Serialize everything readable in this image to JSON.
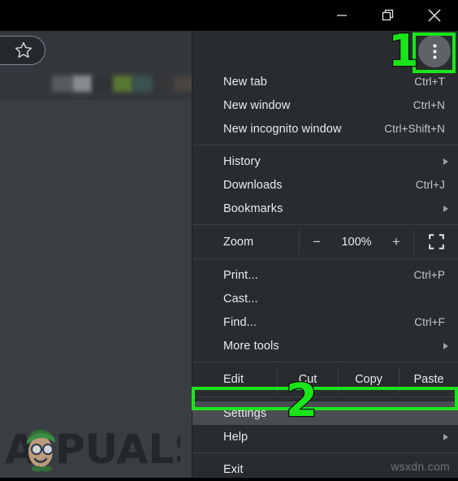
{
  "window": {
    "controls": [
      {
        "name": "minimize-button",
        "icon": "minimize-icon",
        "label": "Minimize"
      },
      {
        "name": "restore-button",
        "icon": "restore-icon",
        "label": "Restore"
      },
      {
        "name": "close-button",
        "icon": "close-icon",
        "label": "Close"
      }
    ]
  },
  "toolbar": {
    "bookmark_star": {
      "icon": "star-icon",
      "label": "Bookmark this tab"
    },
    "bookmark_row1_colors": [
      "#5a5d62",
      "#8d9196",
      "#2f3236",
      "#5c7a33",
      "#3c5550",
      "#343638",
      "#4a4540",
      "#7d6a57",
      "#2f3236",
      "#3ebda0",
      "#2e8c78",
      "#6e2b2b",
      "#e0665f",
      "#6a4238",
      "#b8762e",
      "#4a4d52",
      "#5d7a2c",
      "#a8d84a",
      "#6d2a2a",
      "#3a3d42"
    ],
    "bookmark_row2_colors": [
      "#3a3d42",
      "#54575c",
      "#4e5156",
      "#44474c",
      "#3e4146",
      "#2f3236",
      "#9ba0a5",
      "#60636a",
      "#54575c",
      "#4a4d52",
      "#5c5f64",
      "#4e5156",
      "#585b60",
      "#4a4d52",
      "#60636a",
      "#515459"
    ]
  },
  "menu": {
    "sections": [
      {
        "name": "new-section",
        "items": [
          {
            "name": "menu-item-new-tab",
            "label": "New tab",
            "accel": "Ctrl+T",
            "submenu": false
          },
          {
            "name": "menu-item-new-window",
            "label": "New window",
            "accel": "Ctrl+N",
            "submenu": false
          },
          {
            "name": "menu-item-new-incognito-window",
            "label": "New incognito window",
            "accel": "Ctrl+Shift+N",
            "submenu": false
          }
        ]
      },
      {
        "name": "browse-section",
        "items": [
          {
            "name": "menu-item-history",
            "label": "History",
            "accel": "",
            "submenu": true
          },
          {
            "name": "menu-item-downloads",
            "label": "Downloads",
            "accel": "Ctrl+J",
            "submenu": false
          },
          {
            "name": "menu-item-bookmarks",
            "label": "Bookmarks",
            "accel": "",
            "submenu": true
          }
        ]
      },
      {
        "name": "tools-section",
        "items": [
          {
            "name": "menu-item-print",
            "label": "Print...",
            "accel": "Ctrl+P",
            "submenu": false
          },
          {
            "name": "menu-item-cast",
            "label": "Cast...",
            "accel": "",
            "submenu": false
          },
          {
            "name": "menu-item-find",
            "label": "Find...",
            "accel": "Ctrl+F",
            "submenu": false
          },
          {
            "name": "menu-item-more-tools",
            "label": "More tools",
            "accel": "",
            "submenu": true
          }
        ]
      },
      {
        "name": "bottom-section",
        "items": [
          {
            "name": "menu-item-settings",
            "label": "Settings",
            "accel": "",
            "submenu": false
          },
          {
            "name": "menu-item-help",
            "label": "Help",
            "accel": "",
            "submenu": true
          }
        ]
      },
      {
        "name": "exit-section",
        "items": [
          {
            "name": "menu-item-exit",
            "label": "Exit",
            "accel": "",
            "submenu": false
          }
        ]
      }
    ],
    "zoom_row": {
      "label": "Zoom",
      "decrease": "−",
      "value": "100%",
      "increase": "+",
      "fullscreen_icon": "fullscreen-icon"
    },
    "edit_row": {
      "label": "Edit",
      "cut": "Cut",
      "copy": "Copy",
      "paste": "Paste"
    },
    "more_button": {
      "name": "chrome-menu-button",
      "icon": "three-dots-vertical-icon"
    }
  },
  "annotations": [
    {
      "name": "step-1-marker",
      "number": "1",
      "color": "#1ae51a",
      "target": "chrome-menu-button"
    },
    {
      "name": "step-2-marker",
      "number": "2",
      "color": "#1ae51a",
      "target": "menu-item-settings"
    }
  ],
  "watermarks": {
    "brand": "APPUALS",
    "site": "wsxdn.com"
  }
}
